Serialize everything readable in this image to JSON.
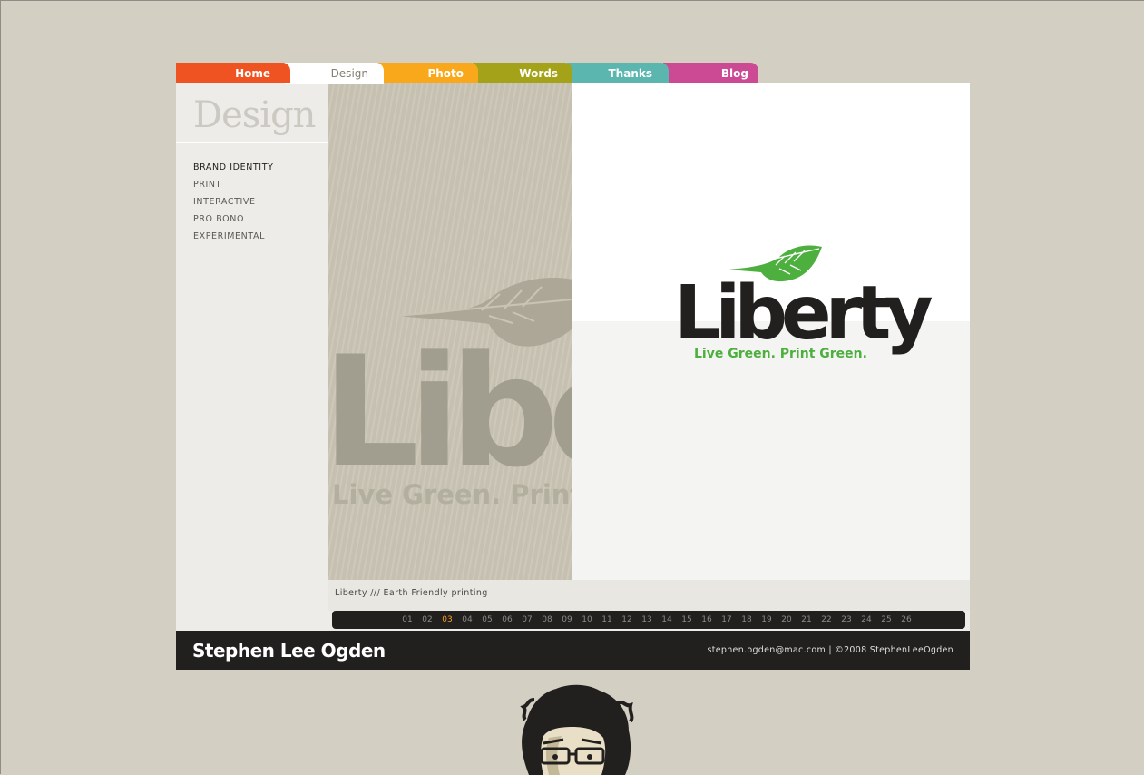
{
  "nav": {
    "tabs": [
      {
        "label": "Home",
        "color": "#f05322"
      },
      {
        "label": "Design",
        "color": "#ffffff",
        "active": true
      },
      {
        "label": "Photo",
        "color": "#f9a81c"
      },
      {
        "label": "Words",
        "color": "#a4a219"
      },
      {
        "label": "Thanks",
        "color": "#5cb6b0"
      },
      {
        "label": "Blog",
        "color": "#cc4a93"
      }
    ]
  },
  "section": {
    "title": "Design",
    "categories": [
      "BRAND IDENTITY",
      "PRINT",
      "INTERACTIVE",
      "PRO BONO",
      "EXPERIMENTAL"
    ],
    "active_category": "BRAND IDENTITY"
  },
  "project": {
    "logo_wordmark": "Liberty",
    "logo_tagline": "Live Green. Print Green.",
    "preview_wordmark": "Liber",
    "preview_tagline": "Live Green. Print",
    "caption": "Liberty  ///  Earth Friendly printing",
    "brand_green": "#4caf3e"
  },
  "pager": {
    "pages": [
      "01",
      "02",
      "03",
      "04",
      "05",
      "06",
      "07",
      "08",
      "09",
      "10",
      "11",
      "12",
      "13",
      "14",
      "15",
      "16",
      "17",
      "18",
      "19",
      "20",
      "21",
      "22",
      "23",
      "24",
      "25",
      "26"
    ],
    "current": "03"
  },
  "footer": {
    "name": "Stephen Lee Ogden",
    "email": "stephen.ogden@mac.com",
    "separator": "|",
    "copyright": "©2008 StephenLeeOgden"
  },
  "portrait_icon": "portrait-illustration"
}
